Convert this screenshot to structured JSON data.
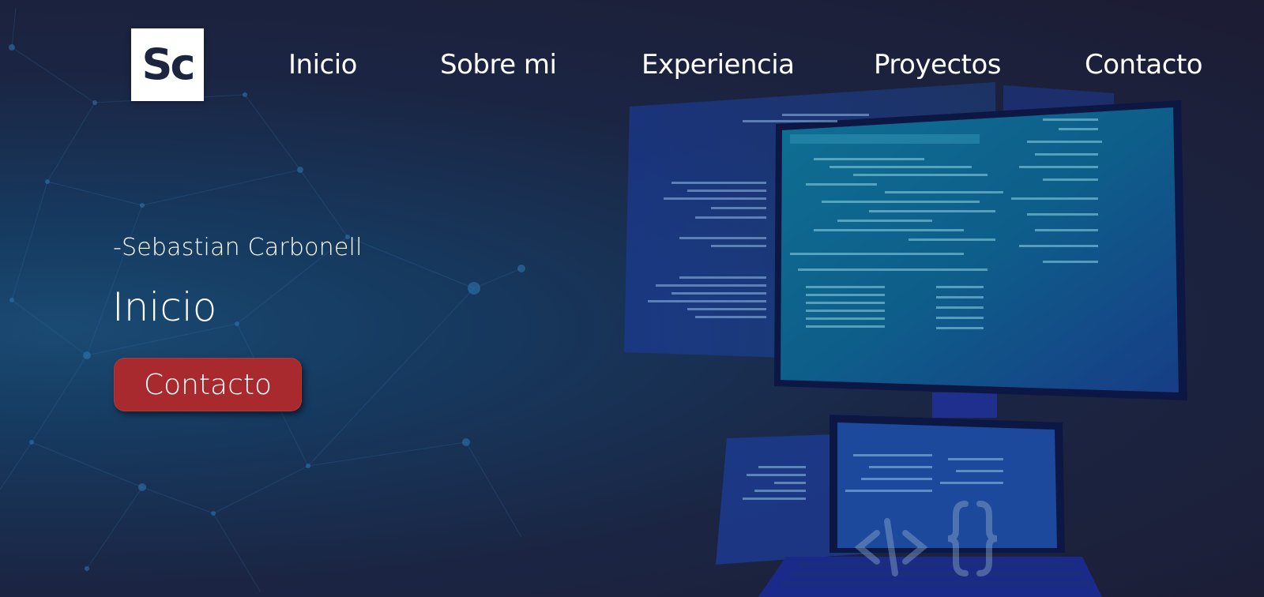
{
  "logo": {
    "text": "Sc"
  },
  "nav": {
    "items": [
      {
        "label": "Inicio"
      },
      {
        "label": "Sobre mi"
      },
      {
        "label": "Experiencia"
      },
      {
        "label": "Proyectos"
      },
      {
        "label": "Contacto"
      }
    ]
  },
  "hero": {
    "subtitle": "-Sebastian Carbonell",
    "title": "Inicio",
    "cta_label": "Contacto"
  },
  "colors": {
    "background": "#1c1c33",
    "accent": "#a92a2e",
    "network": "#2f78b4"
  },
  "illustration": {
    "code_icon": "</>",
    "braces_icon": "{ }"
  }
}
